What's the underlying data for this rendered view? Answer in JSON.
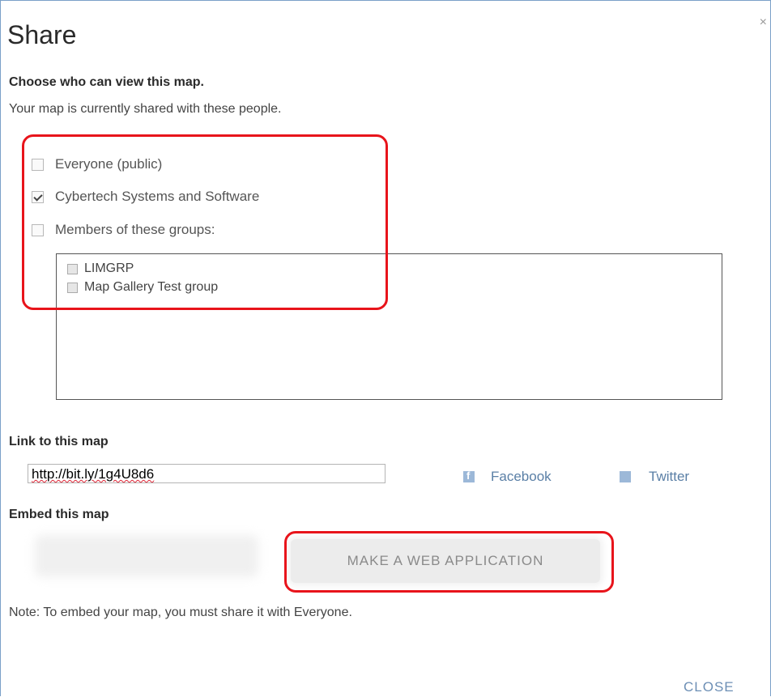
{
  "dialog": {
    "title": "Share",
    "close_icon": "×",
    "choose_heading": "Choose who can view this map.",
    "shared_text": "Your map is currently shared with these people.",
    "options": [
      {
        "label": "Everyone (public)",
        "checked": false
      },
      {
        "label": "Cybertech Systems and Software",
        "checked": true
      },
      {
        "label": "Members of these groups:",
        "checked": false
      }
    ],
    "groups": [
      {
        "label": "LIMGRP",
        "checked": false
      },
      {
        "label": "Map Gallery Test group",
        "checked": false
      }
    ],
    "link_heading": "Link to this map",
    "link_value": "http://bit.ly/1g4U8d6",
    "social": {
      "facebook": "Facebook",
      "twitter": "Twitter",
      "facebook_icon": "facebook-icon",
      "twitter_icon": "twitter-icon"
    },
    "embed_heading": "Embed this map",
    "make_web_app": "MAKE A WEB APPLICATION",
    "note": "Note: To embed your map, you must share it with Everyone.",
    "close_label": "CLOSE"
  },
  "colors": {
    "highlight": "#e8141b",
    "link": "#6d8fb5"
  }
}
